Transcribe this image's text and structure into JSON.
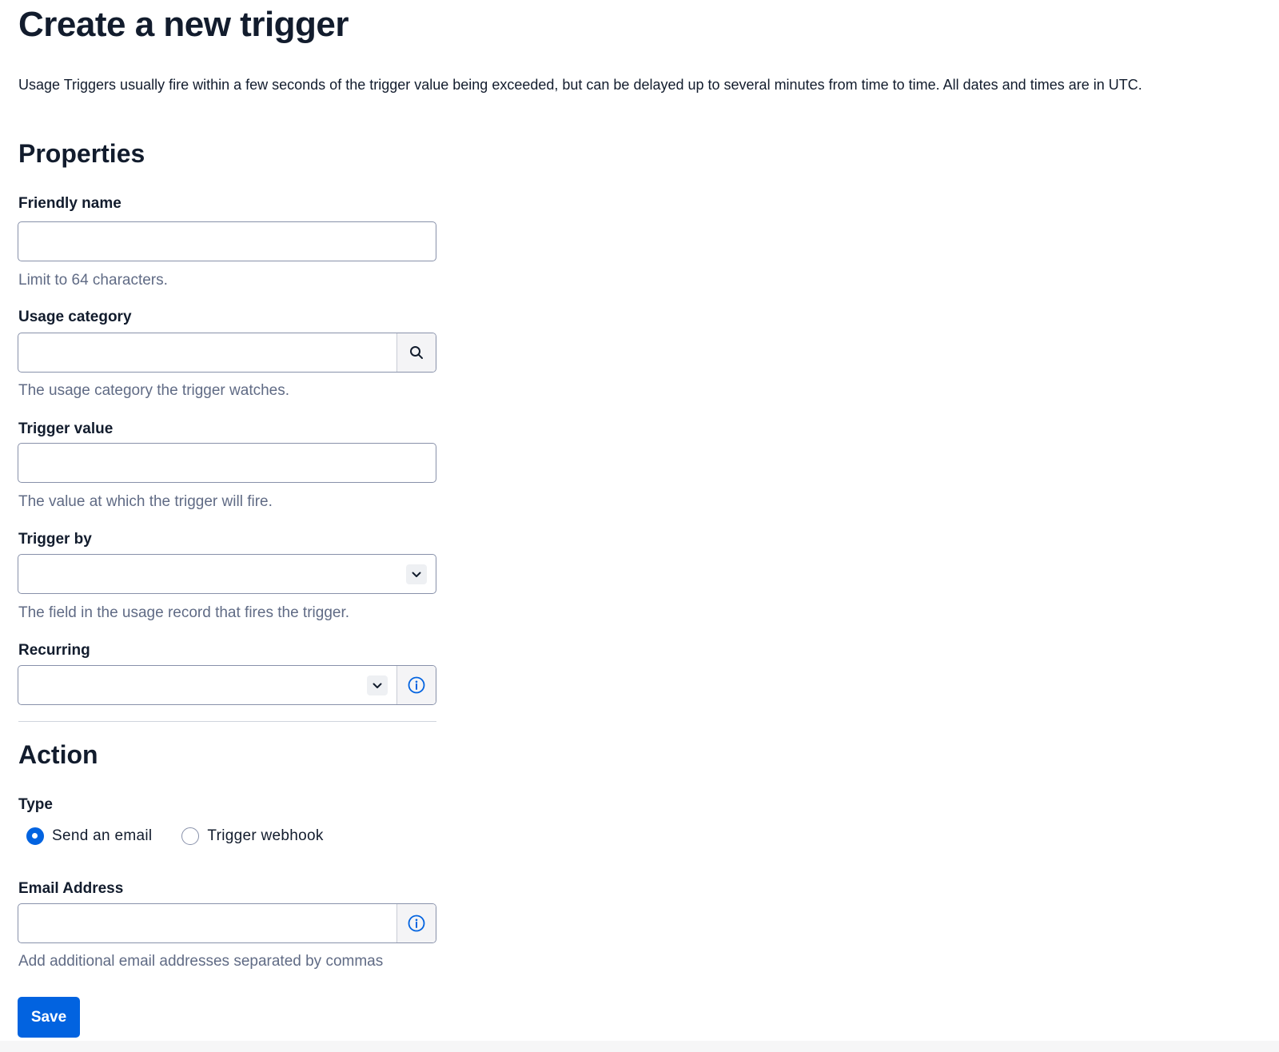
{
  "page": {
    "title": "Create a new trigger",
    "intro": "Usage Triggers usually fire within a few seconds of the trigger value being exceeded, but can be delayed up to several minutes from time to time. All dates and times are in UTC."
  },
  "properties": {
    "heading": "Properties",
    "friendly_name": {
      "label": "Friendly name",
      "value": "",
      "help": "Limit to 64 characters."
    },
    "usage_category": {
      "label": "Usage category",
      "value": "",
      "help": "The usage category the trigger watches."
    },
    "trigger_value": {
      "label": "Trigger value",
      "value": "",
      "help": "The value at which the trigger will fire."
    },
    "trigger_by": {
      "label": "Trigger by",
      "value": "",
      "help": "The field in the usage record that fires the trigger."
    },
    "recurring": {
      "label": "Recurring",
      "value": ""
    }
  },
  "action": {
    "heading": "Action",
    "type_label": "Type",
    "options": [
      {
        "label": "Send an email",
        "checked": true
      },
      {
        "label": "Trigger webhook",
        "checked": false
      }
    ],
    "email": {
      "label": "Email Address",
      "value": "",
      "help": "Add additional email addresses separated by commas"
    }
  },
  "buttons": {
    "save": "Save"
  },
  "colors": {
    "primary": "#0263e0",
    "text": "#121c2d",
    "muted": "#606b85",
    "border": "#8891aa"
  },
  "icons": {
    "search": "search-icon",
    "chevron": "chevron-down-icon",
    "info": "info-icon"
  }
}
